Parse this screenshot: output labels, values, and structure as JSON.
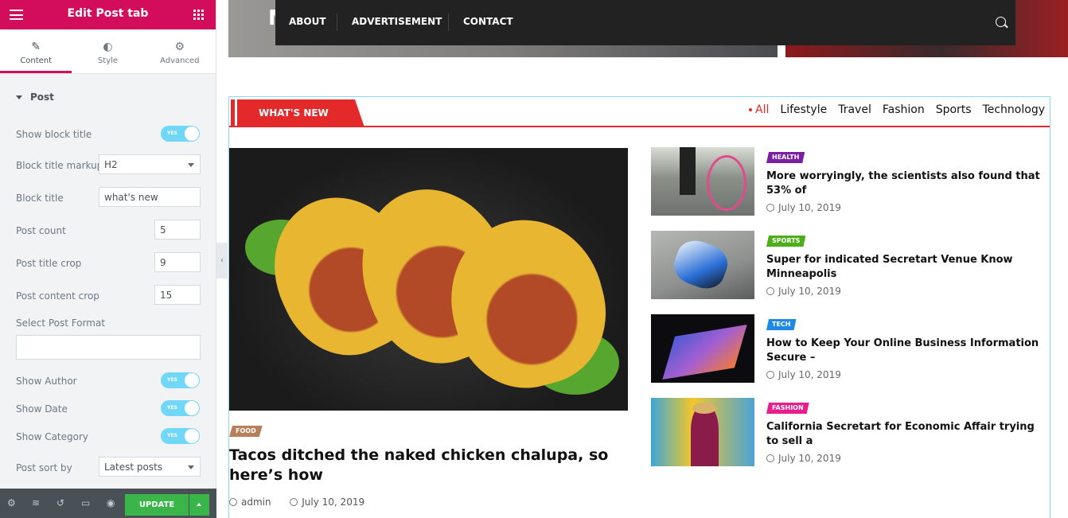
{
  "editor": {
    "title": "Edit Post tab",
    "tabs": [
      {
        "icon": "pencil-icon",
        "label": "Content"
      },
      {
        "icon": "half-circle-icon",
        "label": "Style"
      },
      {
        "icon": "gear-icon",
        "label": "Advanced"
      }
    ],
    "section": "Post",
    "show_block_title": {
      "label": "Show block title",
      "value": "YES"
    },
    "block_title_markup": {
      "label": "Block title markup",
      "value": "H2"
    },
    "block_title": {
      "label": "Block title",
      "value": "what's new"
    },
    "post_count": {
      "label": "Post count",
      "value": "5"
    },
    "post_title_crop": {
      "label": "Post title crop",
      "value": "9"
    },
    "post_content_crop": {
      "label": "Post content crop",
      "value": "15"
    },
    "select_post_format": {
      "label": "Select Post Format",
      "value": ""
    },
    "show_author": {
      "label": "Show Author",
      "value": "YES"
    },
    "show_date": {
      "label": "Show Date",
      "value": "YES"
    },
    "show_category": {
      "label": "Show Category",
      "value": "YES"
    },
    "post_sort_by": {
      "label": "Post sort by",
      "value": "Latest posts"
    },
    "update_label": "UPDATE"
  },
  "site": {
    "nav": [
      "ABOUT",
      "ADVERTISEMENT",
      "CONTACT"
    ],
    "logo_fragment": "M",
    "block_title": "WHAT'S NEW",
    "filters": [
      "All",
      "Lifestyle",
      "Travel",
      "Fashion",
      "Sports",
      "Technology"
    ],
    "main": {
      "category": "FOOD",
      "category_color": "#b8805a",
      "title": "Tacos ditched the naked chicken chalupa, so here’s how",
      "author": "admin",
      "date": "July 10, 2019"
    },
    "side": [
      {
        "category": "HEALTH",
        "color": "#7a1fa2",
        "title": "More worryingly, the scientists also found that 53% of",
        "date": "July 10, 2019"
      },
      {
        "category": "SPORTS",
        "color": "#4caf1a",
        "title": "Super for indicated Secretart Venue Know Minneapolis",
        "date": "July 10, 2019"
      },
      {
        "category": "TECH",
        "color": "#1e88e5",
        "title": "How to Keep Your Online Business Information Secure –",
        "date": "July 10, 2019"
      },
      {
        "category": "FASHION",
        "color": "#e91e8c",
        "title": "California Secretart for Economic Affair trying to sell a",
        "date": "July 10, 2019"
      }
    ]
  }
}
